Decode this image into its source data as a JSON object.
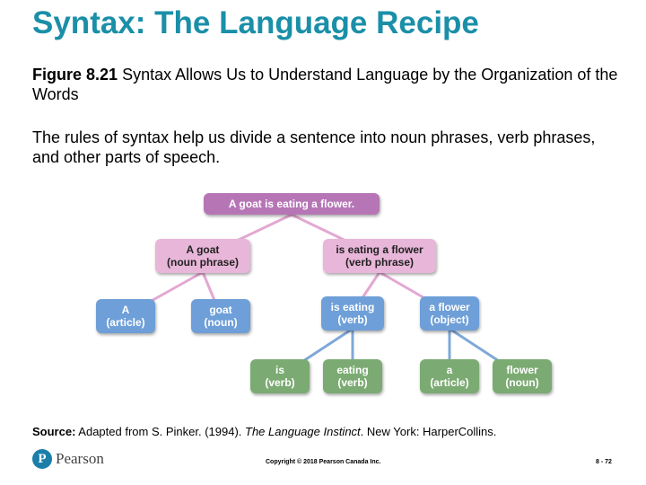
{
  "title": "Syntax: The Language Recipe",
  "figure": {
    "label": "Figure 8.21",
    "caption": "Syntax Allows Us to Understand Language by the Organization of the Words"
  },
  "description": "The rules of syntax help us divide a sentence into noun phrases, verb phrases, and other parts of speech.",
  "tree": {
    "root": {
      "line1": "A goat is eating a flower."
    },
    "noun_phrase": {
      "line1": "A goat",
      "line2": "(noun phrase)"
    },
    "verb_phrase": {
      "line1": "is eating a flower",
      "line2": "(verb phrase)"
    },
    "article_a": {
      "line1": "A",
      "line2": "(article)"
    },
    "noun_goat": {
      "line1": "goat",
      "line2": "(noun)"
    },
    "verb_is_eating": {
      "line1": "is eating",
      "line2": "(verb)"
    },
    "object_a_flower": {
      "line1": "a flower",
      "line2": "(object)"
    },
    "verb_is": {
      "line1": "is",
      "line2": "(verb)"
    },
    "verb_eating": {
      "line1": "eating",
      "line2": "(verb)"
    },
    "article_a2": {
      "line1": "a",
      "line2": "(article)"
    },
    "noun_flower": {
      "line1": "flower",
      "line2": "(noun)"
    }
  },
  "source": {
    "label": "Source:",
    "text_before": " Adapted from S. Pinker. (1994). ",
    "book": "The Language Instinct",
    "text_after": ". New York: HarperCollins."
  },
  "footer": {
    "logo_icon": "pearson-p-icon",
    "logo_letter": "P",
    "logo_text": "Pearson",
    "copyright": "Copyright © 2018 Pearson Canada Inc.",
    "page": "8 - 72"
  },
  "colors": {
    "title": "#1a8fa8",
    "root": "#b676b6",
    "phrase": "#e8b6d8",
    "phrase_line": "#e3a8d2",
    "mid": "#6e9fd8",
    "mid_line": "#7fa8d8",
    "leaf": "#7bab72"
  }
}
